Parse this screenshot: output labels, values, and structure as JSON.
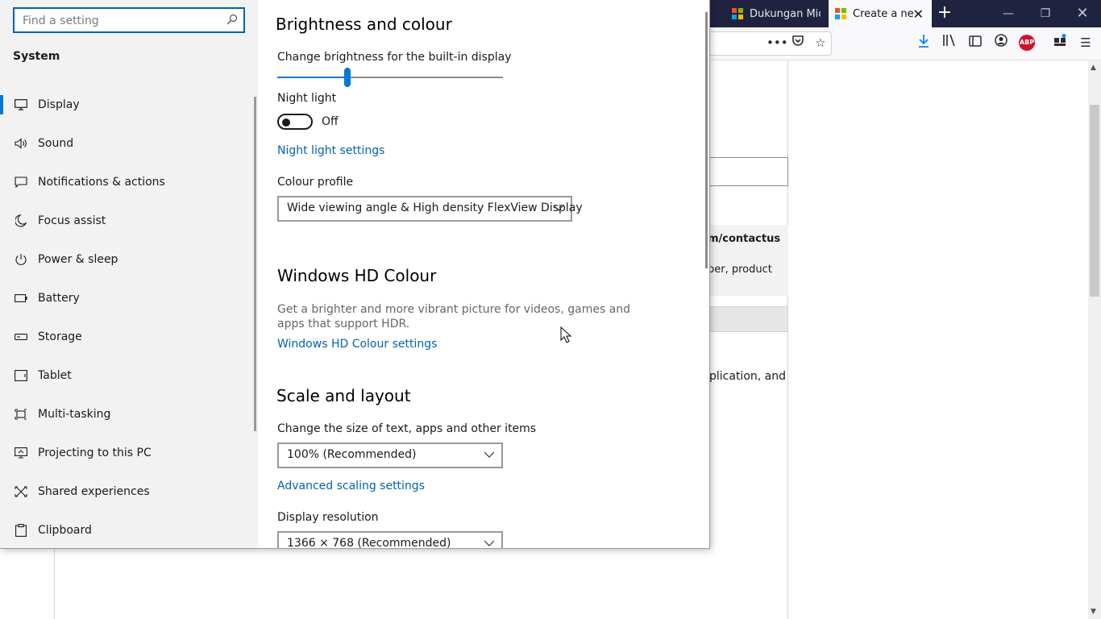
{
  "browser": {
    "tabs": [
      {
        "label": "Dukungan Micr",
        "active": false
      },
      {
        "label": "Create a new",
        "active": true
      }
    ],
    "window_controls": {
      "minimize": "—",
      "maximize": "❐",
      "close": "✕"
    },
    "toolbar_icons": [
      "more-icon",
      "pocket-icon",
      "bookmark-star-icon",
      "download-icon",
      "library-icon",
      "reader-icon",
      "account-icon",
      "adblock-icon",
      "extensions-icon",
      "menu-icon"
    ],
    "abp_label": "ABP",
    "page_fragments": {
      "contact": "m/contactus",
      "product": "ber, product",
      "application": "plication, and"
    }
  },
  "settings": {
    "search": {
      "placeholder": "Find a setting",
      "value": ""
    },
    "section_label": "System",
    "nav": [
      {
        "label": "Display",
        "icon": "monitor-icon",
        "active": true
      },
      {
        "label": "Sound",
        "icon": "speaker-icon"
      },
      {
        "label": "Notifications & actions",
        "icon": "notification-icon"
      },
      {
        "label": "Focus assist",
        "icon": "moon-icon"
      },
      {
        "label": "Power & sleep",
        "icon": "power-icon"
      },
      {
        "label": "Battery",
        "icon": "battery-icon"
      },
      {
        "label": "Storage",
        "icon": "storage-icon"
      },
      {
        "label": "Tablet",
        "icon": "tablet-icon"
      },
      {
        "label": "Multi-tasking",
        "icon": "multitasking-icon"
      },
      {
        "label": "Projecting to this PC",
        "icon": "projecting-icon"
      },
      {
        "label": "Shared experiences",
        "icon": "shared-icon"
      },
      {
        "label": "Clipboard",
        "icon": "clipboard-icon"
      }
    ],
    "brightness": {
      "heading": "Brightness and colour",
      "slider_label": "Change brightness for the built-in display",
      "slider_value": 0.31
    },
    "night_light": {
      "label": "Night light",
      "state": "Off",
      "settings_link": "Night light settings"
    },
    "colour_profile": {
      "label": "Colour profile",
      "value": "Wide viewing angle & High density FlexView Display"
    },
    "hd_colour": {
      "heading": "Windows HD Colour",
      "description": "Get a brighter and more vibrant picture for videos, games and apps that support HDR.",
      "link": "Windows HD Colour settings"
    },
    "scale": {
      "heading": "Scale and layout",
      "size_label": "Change the size of text, apps and other items",
      "size_value": "100% (Recommended)",
      "advanced_link": "Advanced scaling settings",
      "resolution_label": "Display resolution",
      "resolution_value": "1366 × 768 (Recommended)"
    },
    "accent_color": "#0078d7",
    "link_color": "#0063b1"
  }
}
